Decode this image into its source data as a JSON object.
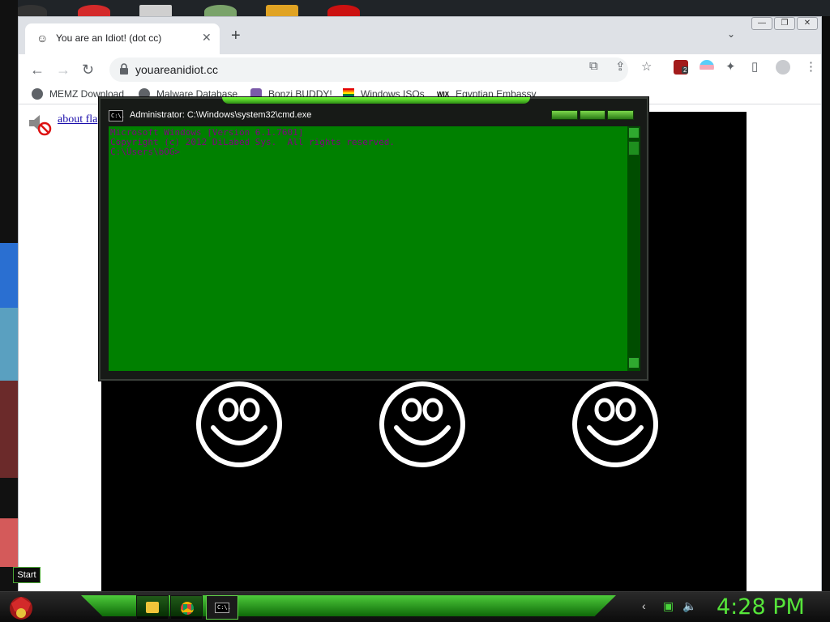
{
  "browser": {
    "tab_title": "You are an Idiot! (dot cc)",
    "url": "youareanidiot.cc",
    "bookmarks": [
      {
        "label": "MEMZ Download",
        "icon": "globe-icon"
      },
      {
        "label": "Malware Database",
        "icon": "globe-icon"
      },
      {
        "label": "Bonzi BUDDY!",
        "icon": "bonzi-icon"
      },
      {
        "label": "Windows ISOs",
        "icon": "rainbow-flag-icon"
      },
      {
        "label": "Egyptian Embassy",
        "icon": "wix-icon"
      }
    ],
    "bookmark_wix_text": "WIX",
    "ext_badge": "2",
    "content": {
      "links_text": "about fla"
    }
  },
  "cmd": {
    "title": "Administrator: C:\\Windows\\system32\\cmd.exe",
    "icon_text": "C:\\.",
    "lines": [
      "Microsoft Windows [Version 6.1.7601]",
      "Copyright (c) 2012 DiLabed Sys.  All rights reserved.",
      "",
      "C:\\Users\\bOG>"
    ]
  },
  "taskbar": {
    "start_label": "Start",
    "clock": "4:28 PM",
    "cmd_app_text": "C:\\."
  },
  "colors": {
    "cmd_background": "#008000",
    "cmd_text": "#800080",
    "clock": "#56e63a",
    "theme_green": "#4fd43c"
  }
}
